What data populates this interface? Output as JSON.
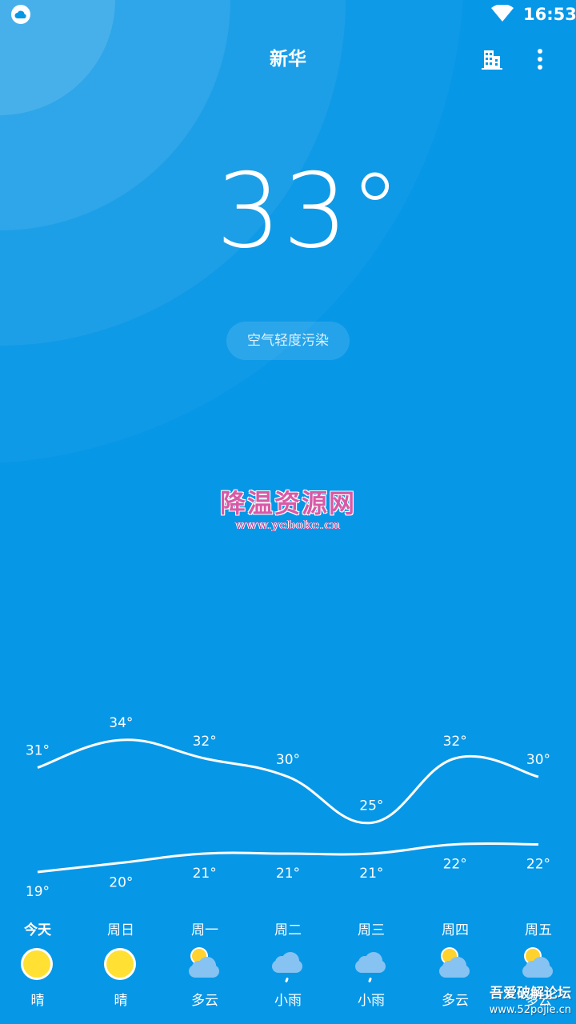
{
  "status_bar": {
    "left_icon": "weather-notification-icon",
    "wifi_icon": "wifi-icon",
    "time": "16:53"
  },
  "header": {
    "city": "新华",
    "city_manage_icon": "city-buildings-icon",
    "menu_icon": "more-vert-icon"
  },
  "current": {
    "temperature": "33°",
    "air_quality": "空气轻度污染"
  },
  "watermark": {
    "title": "降温资源网",
    "url": "www.yeboke.cn"
  },
  "forecast": [
    {
      "day": "今天",
      "high": 31,
      "low": 19,
      "high_label": "31°",
      "low_label": "19°",
      "condition": "晴",
      "icon": "sun-icon"
    },
    {
      "day": "周日",
      "high": 34,
      "low": 20,
      "high_label": "34°",
      "low_label": "20°",
      "condition": "晴",
      "icon": "sun-icon"
    },
    {
      "day": "周一",
      "high": 32,
      "low": 21,
      "high_label": "32°",
      "low_label": "21°",
      "condition": "多云",
      "icon": "partly-cloudy-icon"
    },
    {
      "day": "周二",
      "high": 30,
      "low": 21,
      "high_label": "30°",
      "low_label": "21°",
      "condition": "小雨",
      "icon": "light-rain-icon"
    },
    {
      "day": "周三",
      "high": 25,
      "low": 21,
      "high_label": "25°",
      "low_label": "21°",
      "condition": "小雨",
      "icon": "light-rain-icon"
    },
    {
      "day": "周四",
      "high": 32,
      "low": 22,
      "high_label": "32°",
      "low_label": "22°",
      "condition": "多云",
      "icon": "partly-cloudy-icon"
    },
    {
      "day": "周五",
      "high": 30,
      "low": 22,
      "high_label": "30°",
      "low_label": "22°",
      "condition": "多云",
      "icon": "partly-cloudy-icon"
    }
  ],
  "forum_watermark": {
    "title": "吾爱破解论坛",
    "url": "www.52pojie.cn"
  },
  "colors": {
    "background": "#0797e7",
    "text": "#ffffff",
    "sun": "#ffe033",
    "cloud": "#86c3f2"
  }
}
